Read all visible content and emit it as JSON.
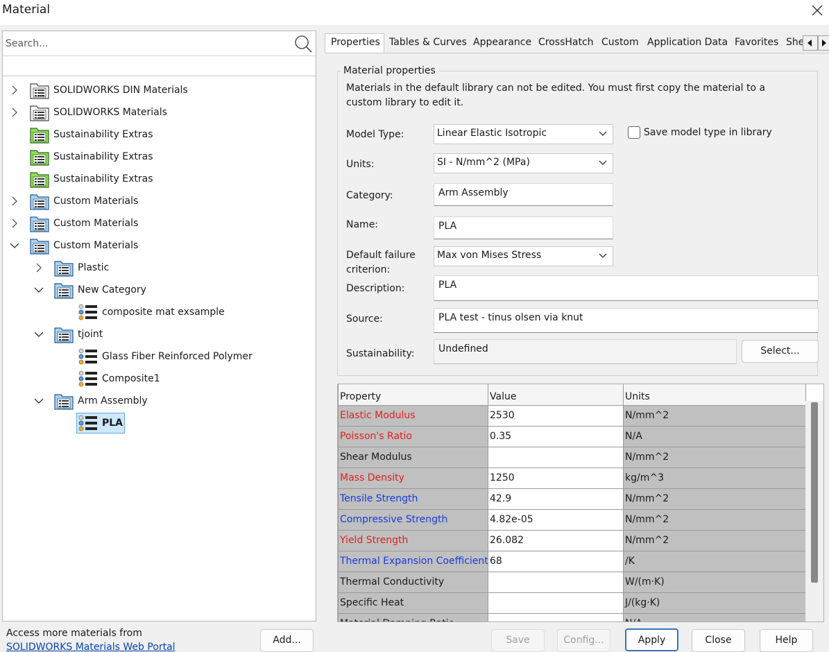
{
  "window": {
    "title": "Material"
  },
  "search": {
    "placeholder": "Search..."
  },
  "tree": [
    {
      "label": "SOLIDWORKS DIN Materials",
      "kind": "library-gray",
      "expander": "collapsed"
    },
    {
      "label": "SOLIDWORKS Materials",
      "kind": "library-gray",
      "expander": "collapsed"
    },
    {
      "label": "Sustainability Extras",
      "kind": "library-green",
      "expander": "none"
    },
    {
      "label": "Sustainability Extras",
      "kind": "library-green",
      "expander": "none"
    },
    {
      "label": "Sustainability Extras",
      "kind": "library-green",
      "expander": "none"
    },
    {
      "label": "Custom Materials",
      "kind": "library-blue",
      "expander": "collapsed"
    },
    {
      "label": "Custom Materials",
      "kind": "library-blue",
      "expander": "collapsed"
    },
    {
      "label": "Custom Materials",
      "kind": "library-blue",
      "expander": "expanded"
    },
    {
      "label": "Plastic",
      "kind": "category",
      "expander": "collapsed"
    },
    {
      "label": "New Category",
      "kind": "category",
      "expander": "expanded"
    },
    {
      "label": "composite mat exsample",
      "kind": "material",
      "expander": "none"
    },
    {
      "label": "tjoint",
      "kind": "category",
      "expander": "expanded"
    },
    {
      "label": "Glass Fiber Reinforced Polymer",
      "kind": "material",
      "expander": "none"
    },
    {
      "label": "Composite1",
      "kind": "material",
      "expander": "none"
    },
    {
      "label": "Arm Assembly",
      "kind": "category",
      "expander": "expanded"
    },
    {
      "label": "PLA",
      "kind": "material",
      "expander": "none",
      "selected": true
    }
  ],
  "tabs": [
    "Properties",
    "Tables & Curves",
    "Appearance",
    "CrossHatch",
    "Custom",
    "Application Data",
    "Favorites",
    "She"
  ],
  "properties": {
    "group_title": "Material properties",
    "note": "Materials in the default library can not be edited. You must first copy the material to a custom library to edit it.",
    "model_type_label": "Model Type:",
    "model_type_value": "Linear Elastic Isotropic",
    "save_model_type_label": "Save model type in library",
    "save_model_type_checked": false,
    "units_label": "Units:",
    "units_value": "SI - N/mm^2 (MPa)",
    "category_label": "Category:",
    "category_value": "Arm Assembly",
    "name_label": "Name:",
    "name_value": "PLA",
    "failure_label_line1": "Default failure",
    "failure_label_line2": "criterion:",
    "failure_value": "Max von Mises Stress",
    "description_label": "Description:",
    "description_value": "PLA",
    "source_label": "Source:",
    "source_value": "PLA test - tinus olsen via knut",
    "sustainability_label": "Sustainability:",
    "sustainability_value": "Undefined",
    "select_button": "Select..."
  },
  "table": {
    "headers": [
      "Property",
      "Value",
      "Units"
    ],
    "rows": [
      {
        "property": "Elastic Modulus",
        "value": "2530",
        "units": "N/mm^2",
        "color": "#e02020"
      },
      {
        "property": "Poisson's Ratio",
        "value": "0.35",
        "units": "N/A",
        "color": "#e02020"
      },
      {
        "property": "Shear Modulus",
        "value": "",
        "units": "N/mm^2",
        "color": "#1a1a1a"
      },
      {
        "property": "Mass Density",
        "value": "1250",
        "units": "kg/m^3",
        "color": "#e02020"
      },
      {
        "property": "Tensile Strength",
        "value": "42.9",
        "units": "N/mm^2",
        "color": "#1a3ad8"
      },
      {
        "property": "Compressive Strength",
        "value": "4.82e-05",
        "units": "N/mm^2",
        "color": "#1a3ad8"
      },
      {
        "property": "Yield Strength",
        "value": "26.082",
        "units": "N/mm^2",
        "color": "#e02020"
      },
      {
        "property": "Thermal Expansion Coefficient",
        "value": "68",
        "units": "/K",
        "color": "#1a3ad8"
      },
      {
        "property": "Thermal Conductivity",
        "value": "",
        "units": "W/(m·K)",
        "color": "#1a1a1a"
      },
      {
        "property": "Specific Heat",
        "value": "",
        "units": "J/(kg·K)",
        "color": "#1a1a1a"
      },
      {
        "property": "Material Damping Ratio",
        "value": "",
        "units": "N/A",
        "color": "#1a1a1a"
      }
    ]
  },
  "footer": {
    "access_text": "Access more materials from",
    "portal_link": "SOLIDWORKS Materials Web Portal",
    "add": "Add...",
    "save": "Save",
    "config": "Config...",
    "apply": "Apply",
    "close": "Close",
    "help": "Help"
  },
  "colors": {
    "required": "#e02020",
    "optional": "#1a3ad8",
    "accent": "#3a73b8",
    "selection": "#cde8ff"
  }
}
